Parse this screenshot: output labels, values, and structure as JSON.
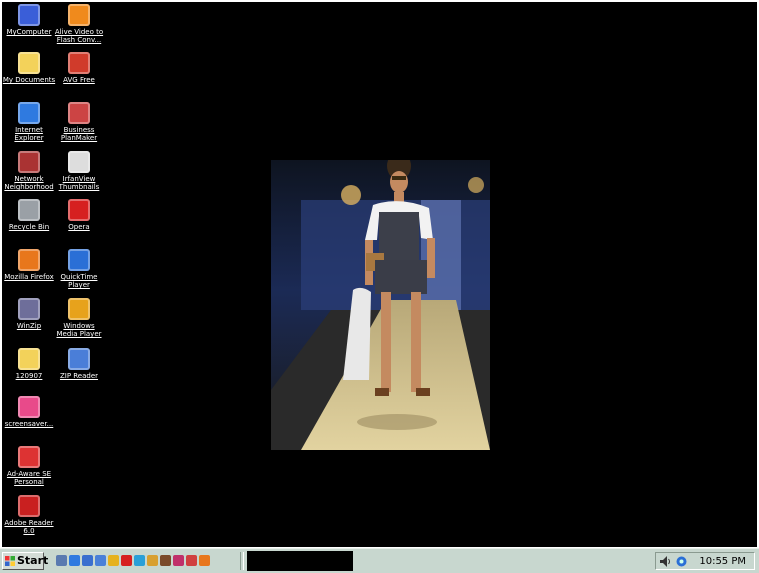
{
  "desktop": {
    "icons": [
      {
        "label": "MyComputer",
        "icon": "my-computer-icon",
        "color": "#3a5ed8"
      },
      {
        "label": "Alive Video to Flash Conv...",
        "icon": "flash-converter-icon",
        "color": "#f08a1c"
      },
      {
        "label": "My Documents",
        "icon": "folder-icon",
        "color": "#f3d25a"
      },
      {
        "label": "AVG Free",
        "icon": "avg-icon",
        "color": "#d03b2b"
      },
      {
        "label": "Internet Explorer",
        "icon": "internet-explorer-icon",
        "color": "#2f7ae0"
      },
      {
        "label": "Business PlanMaker",
        "icon": "planmaker-icon",
        "color": "#cc4444"
      },
      {
        "label": "Network Neighborhood",
        "icon": "network-icon",
        "color": "#a33"
      },
      {
        "label": "IrfanView Thumbnails",
        "icon": "irfanview-icon",
        "color": "#ddd"
      },
      {
        "label": "Recycle Bin",
        "icon": "recycle-bin-icon",
        "color": "#9aa0a6"
      },
      {
        "label": "Opera",
        "icon": "opera-icon",
        "color": "#d62020"
      },
      {
        "label": "Mozilla Firefox",
        "icon": "firefox-icon",
        "color": "#e8771c"
      },
      {
        "label": "QuickTime Player",
        "icon": "quicktime-icon",
        "color": "#2a6fd6"
      },
      {
        "label": "WinZip",
        "icon": "winzip-icon",
        "color": "#6e6e9a"
      },
      {
        "label": "Windows Media Player",
        "icon": "media-player-icon",
        "color": "#e7a21c"
      },
      {
        "label": "120907",
        "icon": "folder-icon",
        "color": "#f3d25a"
      },
      {
        "label": "ZIP Reader",
        "icon": "zip-reader-icon",
        "color": "#4a7ed8"
      },
      {
        "label": "screensaver...",
        "icon": "screensaver-icon",
        "color": "#e84a8a"
      },
      {
        "label": "Ad-Aware SE Personal",
        "icon": "adaware-icon",
        "color": "#d33"
      },
      {
        "label": "Adobe Reader 6.0",
        "icon": "adobe-reader-icon",
        "color": "#c92020"
      }
    ]
  },
  "taskbar": {
    "start_label": "Start",
    "clock": "10:55 PM",
    "quick_launch": [
      {
        "icon": "show-desktop-icon",
        "color": "#5a7ab0"
      },
      {
        "icon": "internet-explorer-icon",
        "color": "#2f7ae0"
      },
      {
        "icon": "outlook-icon",
        "color": "#3a6fcf"
      },
      {
        "icon": "media-icon",
        "color": "#4a80d8"
      },
      {
        "icon": "chrome-icon",
        "color": "#e6b21e"
      },
      {
        "icon": "opera-icon",
        "color": "#d62020"
      },
      {
        "icon": "network-icon",
        "color": "#2aa0d8"
      },
      {
        "icon": "folder-icon",
        "color": "#d8a030"
      },
      {
        "icon": "irfanview-icon",
        "color": "#7a4a2a"
      },
      {
        "icon": "record-icon",
        "color": "#c0306a"
      },
      {
        "icon": "arrow-icon",
        "color": "#d04040"
      },
      {
        "icon": "firefox-icon",
        "color": "#e8771c"
      }
    ],
    "tray_icons": [
      "volume-icon",
      "network-status-icon"
    ]
  }
}
